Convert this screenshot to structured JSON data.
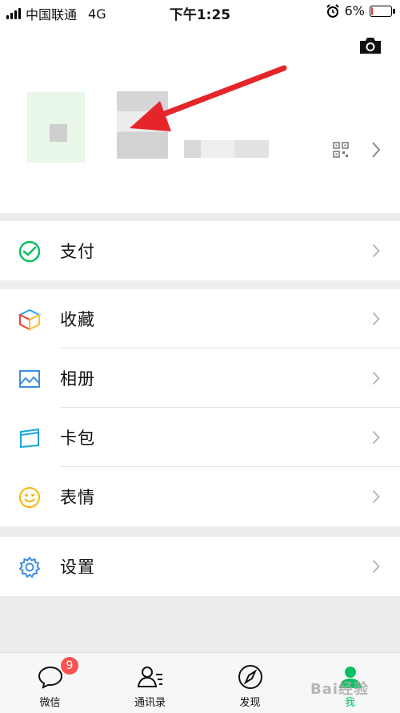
{
  "status": {
    "carrier": "中国联通",
    "network": "4G",
    "time": "下午1:25",
    "battery": "6%",
    "battery_level": 0.06
  },
  "profile": {
    "camera_icon": "camera-icon",
    "qr_icon": "qr-code-icon"
  },
  "menu": {
    "pay": "支付",
    "favorites": "收藏",
    "album": "相册",
    "cards": "卡包",
    "stickers": "表情",
    "settings": "设置"
  },
  "tabs": {
    "chats": "微信",
    "chats_badge": "9",
    "contacts": "通讯录",
    "discover": "发现",
    "me": "我"
  },
  "colors": {
    "accent": "#07c160",
    "badge": "#fa5151",
    "annotation_arrow": "#e5252a"
  },
  "watermark": "Bai经验"
}
